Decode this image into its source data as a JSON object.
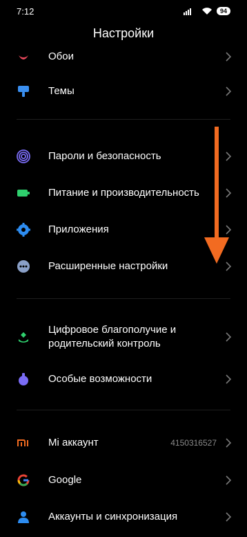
{
  "status_bar": {
    "time": "7:12",
    "battery": "94"
  },
  "header": {
    "title": "Настройки"
  },
  "items": [
    {
      "label": "Обои",
      "icon": "wallpaper-icon"
    },
    {
      "label": "Темы",
      "icon": "themes-icon"
    },
    {
      "label": "Пароли и безопасность",
      "icon": "fingerprint-icon"
    },
    {
      "label": "Питание и производительность",
      "icon": "battery-icon"
    },
    {
      "label": "Приложения",
      "icon": "gear-icon"
    },
    {
      "label": "Расширенные настройки",
      "icon": "more-icon"
    },
    {
      "label": "Цифровое благополучие и родительский контроль",
      "icon": "wellbeing-icon"
    },
    {
      "label": "Особые возможности",
      "icon": "accessibility-icon"
    },
    {
      "label": "Mi аккаунт",
      "value": "4150316527",
      "icon": "mi-logo-icon"
    },
    {
      "label": "Google",
      "icon": "google-icon"
    },
    {
      "label": "Аккаунты и синхронизация",
      "icon": "account-icon"
    }
  ],
  "colors": {
    "background": "#000000",
    "arrow": "#f26b21",
    "divider": "#1f1f1f",
    "chevron": "#7a7a7a"
  }
}
